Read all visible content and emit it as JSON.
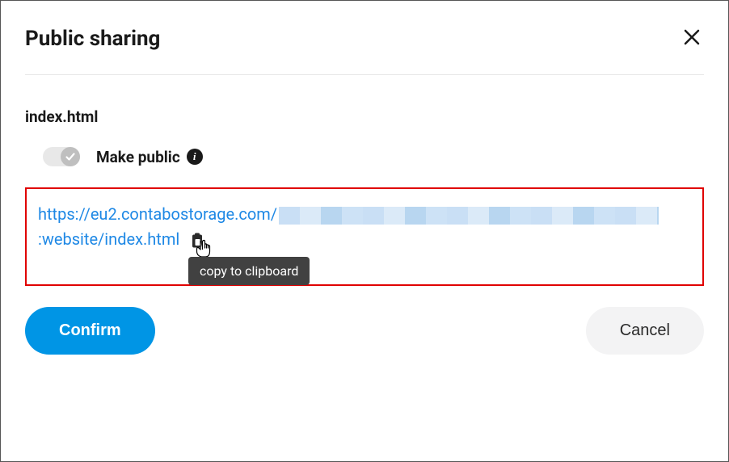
{
  "dialog": {
    "title": "Public sharing",
    "filename": "index.html",
    "toggle_label": "Make public",
    "url_part1": "https://eu2.contabostorage.com/",
    "url_part2": ":website/index.html",
    "tooltip": "copy to clipboard",
    "confirm_label": "Confirm",
    "cancel_label": "Cancel"
  }
}
